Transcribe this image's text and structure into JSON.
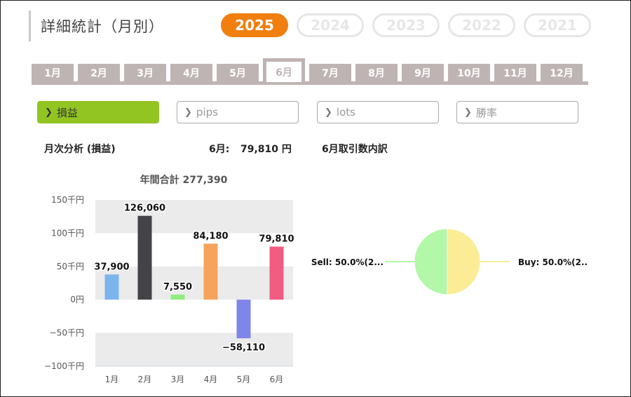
{
  "page": {
    "title": "詳細統計（月別）"
  },
  "years": [
    {
      "label": "2025",
      "active": true
    },
    {
      "label": "2024",
      "active": false
    },
    {
      "label": "2023",
      "active": false
    },
    {
      "label": "2022",
      "active": false
    },
    {
      "label": "2021",
      "active": false
    }
  ],
  "months": [
    "1月",
    "2月",
    "3月",
    "4月",
    "5月",
    "6月",
    "7月",
    "8月",
    "9月",
    "10月",
    "11月",
    "12月"
  ],
  "active_month": "6月",
  "metrics": [
    {
      "label": "損益",
      "active": true
    },
    {
      "label": "pips",
      "active": false
    },
    {
      "label": "lots",
      "active": false
    },
    {
      "label": "勝率",
      "active": false
    }
  ],
  "summary": {
    "monthly_analysis_label": "月次分析 (損益)",
    "month_label": "6月:",
    "month_value": "79,810 円",
    "trade_breakdown_label": "6月取引数内訳"
  },
  "colors": {
    "accent_orange": "#f07f10",
    "accent_green": "#92c522",
    "tab_gray": "#bfb4b4"
  },
  "chart_data": [
    {
      "type": "bar",
      "title": "年間合計 277,390",
      "categories": [
        "1月",
        "2月",
        "3月",
        "4月",
        "5月",
        "6月"
      ],
      "values": [
        37900,
        126060,
        7550,
        84180,
        -58110,
        79810
      ],
      "value_labels": [
        "37,900",
        "126,060",
        "7,550",
        "84,180",
        "−58,110",
        "79,810"
      ],
      "bar_colors": [
        "#7cb5ec",
        "#434348",
        "#90ed7d",
        "#f7a35c",
        "#8085e9",
        "#f15c80"
      ],
      "ylim": [
        -100000,
        150000
      ],
      "yticks": [
        150000,
        100000,
        50000,
        0,
        -50000,
        -100000
      ],
      "ytick_labels": [
        "150千円",
        "100千円",
        "50千円",
        "0円",
        "−50千円",
        "−100千円"
      ],
      "grid": true
    },
    {
      "type": "pie",
      "slices": [
        {
          "label": "Buy: 50.0%(2..",
          "value": 50.0,
          "color": "#fdec96"
        },
        {
          "label": "Sell: 50.0%(2...",
          "value": 50.0,
          "color": "#b3f7a8"
        }
      ]
    }
  ]
}
